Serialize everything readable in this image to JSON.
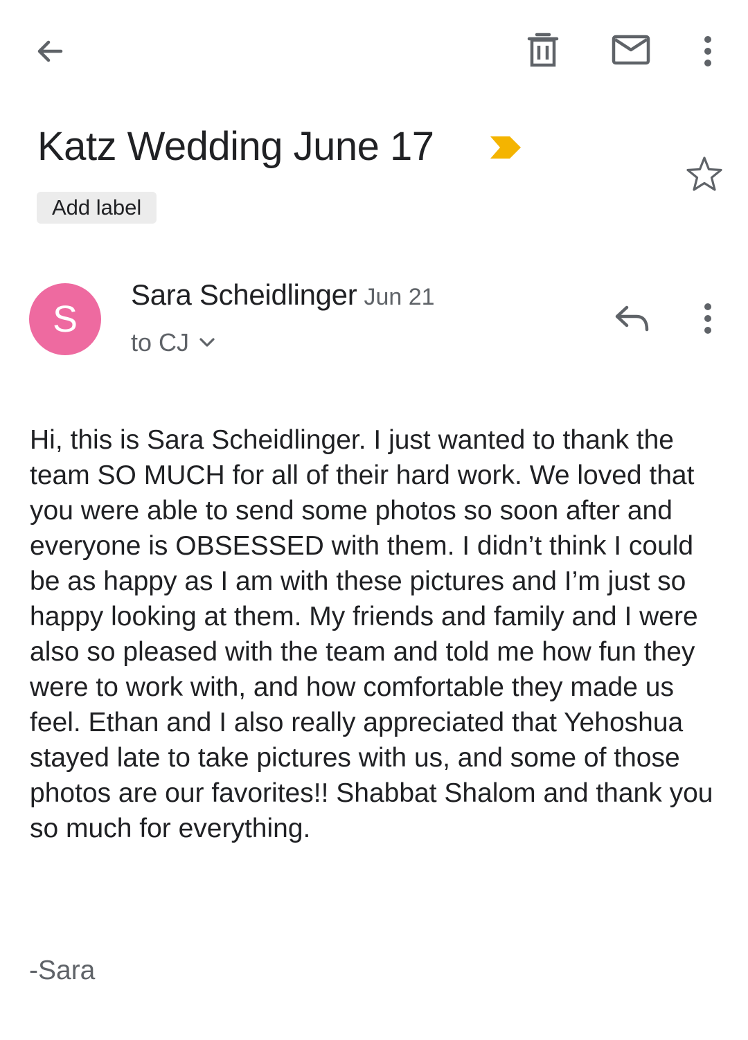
{
  "toolbar": {
    "back_icon": "arrow-back-icon",
    "delete_icon": "trash-icon",
    "mark_unread_icon": "envelope-icon",
    "more_icon": "vertical-dots-icon"
  },
  "email": {
    "subject": "Katz Wedding June 17",
    "importance_icon": "importance-marker-icon",
    "importance_color": "#f4b400",
    "star_icon": "star-outline-icon",
    "label_button": "Add label"
  },
  "message": {
    "avatar_letter": "S",
    "avatar_color": "#ee6aa0",
    "sender": "Sara Scheidlinger",
    "date": "Jun 21",
    "recipient": "to CJ",
    "recipient_expand_icon": "chevron-down-icon",
    "reply_icon": "reply-icon",
    "more_icon": "vertical-dots-icon",
    "body": "Hi, this is Sara Scheidlinger. I just wanted to thank the team SO MUCH for all of their hard work. We loved that you were able to send some photos so soon after and everyone is OBSESSED with them. I didn’t think I could be as happy as I am with these pictures and I’m just so happy looking at them. My friends and family and I were also so pleased with the team and told me how fun they were to work with, and how comfortable they made us feel. Ethan and I also really appreciated that Yehoshua stayed late to take pictures with us, and some of those photos are our favorites!! Shabbat Shalom and thank you so much for everything.",
    "signature": "-Sara"
  }
}
